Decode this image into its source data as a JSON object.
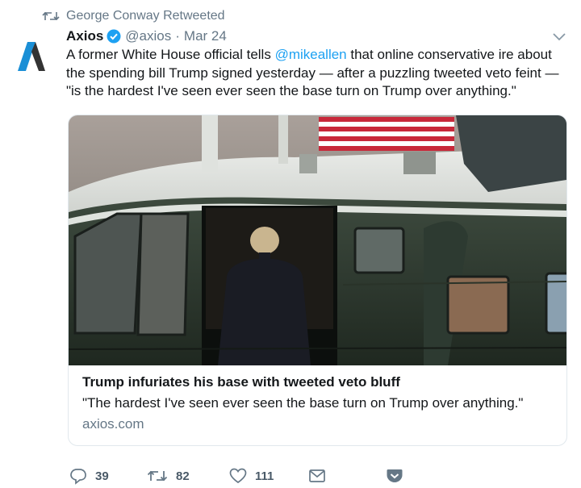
{
  "retweet_context": {
    "text": "George Conway Retweeted",
    "icon": "retweet-icon"
  },
  "author": {
    "name": "Axios",
    "verified": true,
    "handle": "@axios",
    "separator": "·",
    "date": "Mar 24",
    "avatar": "axios-logo"
  },
  "tweet": {
    "text_before_mention": "A former White House official tells ",
    "mention": "@mikeallen",
    "text_after_mention": " that online conservative ire about the spending bill Trump signed yesterday — after a puzzling tweeted veto feint — \"is the hardest I've seen ever seen the base turn on Trump over anything.\""
  },
  "card": {
    "title": "Trump infuriates his base with tweeted veto bluff",
    "description": "\"The hardest I've seen ever seen the base turn on Trump over anything.\"",
    "domain": "axios.com"
  },
  "actions": {
    "reply_count": "39",
    "retweet_count": "82",
    "like_count": "111"
  },
  "colors": {
    "link": "#1da1f2",
    "secondary_text": "#657786",
    "verified_badge": "#1da1f2",
    "axios_brand": "#1a8fd6"
  }
}
